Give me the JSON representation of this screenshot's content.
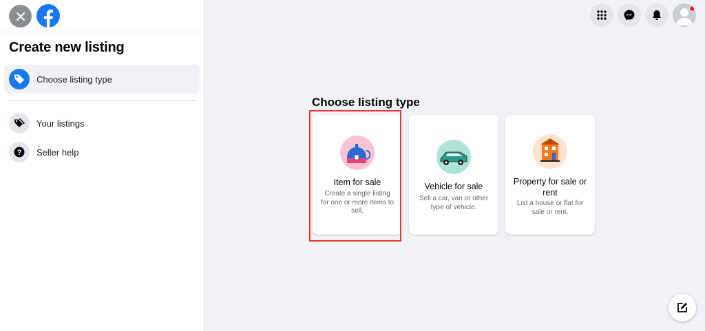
{
  "sidebar": {
    "title": "Create new listing",
    "items": [
      {
        "label": "Choose listing type",
        "icon": "tag-icon"
      },
      {
        "label": "Your listings",
        "icon": "tags-icon"
      },
      {
        "label": "Seller help",
        "icon": "question-icon"
      }
    ]
  },
  "header": {
    "icons": [
      "menu-grid-icon",
      "messenger-icon",
      "bell-icon",
      "avatar"
    ]
  },
  "main": {
    "heading": "Choose listing type",
    "cards": [
      {
        "title": "Item for sale",
        "description": "Create a single listing for one or more items to sell."
      },
      {
        "title": "Vehicle for sale",
        "description": "Sell a car, van or other type of vehicle."
      },
      {
        "title": "Property for sale or rent",
        "description": "List a house or flat for sale or rent."
      }
    ]
  },
  "colors": {
    "accent": "#1877f2",
    "background": "#f0f2f5",
    "highlight": "#e53935"
  }
}
